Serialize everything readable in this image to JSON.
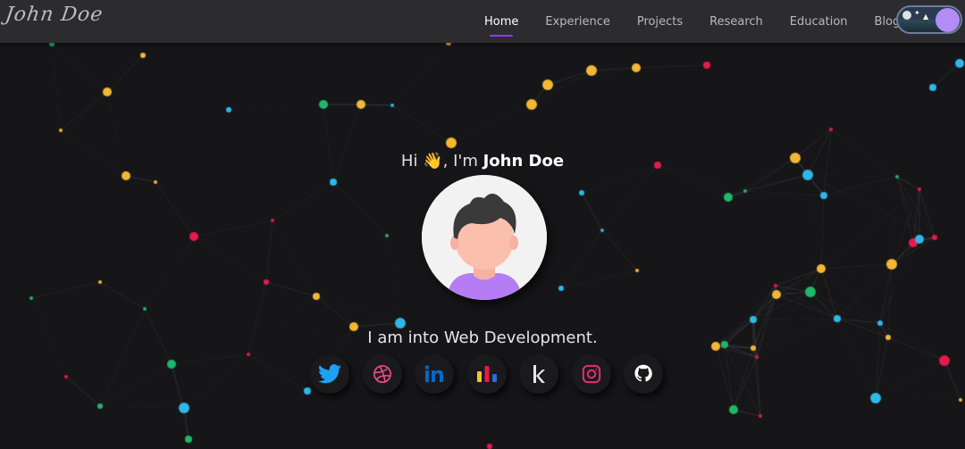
{
  "brand": {
    "logo_text": "John Doe"
  },
  "nav": {
    "items": [
      {
        "label": "Home",
        "active": true
      },
      {
        "label": "Experience",
        "active": false
      },
      {
        "label": "Projects",
        "active": false
      },
      {
        "label": "Research",
        "active": false
      },
      {
        "label": "Education",
        "active": false
      },
      {
        "label": "Blogs",
        "active": false
      }
    ]
  },
  "theme_toggle": {
    "icon": "night-forest-toggle-icon"
  },
  "hero": {
    "greeting_prefix": "Hi",
    "greeting_emoji": "👋",
    "greeting_middle": ", I'm",
    "name": "John Doe",
    "avatar_icon": "user-avatar-icon",
    "tagline": "I am into Web Development."
  },
  "socials": [
    {
      "icon": "twitter-icon",
      "color": "#1da1f2"
    },
    {
      "icon": "dribbble-icon",
      "color": "#ea4c89"
    },
    {
      "icon": "linkedin-icon",
      "color": "#0a66c2"
    },
    {
      "icon": "bar-chart-icon",
      "color": "#f4c430"
    },
    {
      "icon": "kaggle-icon",
      "color": "#e6e6e6"
    },
    {
      "icon": "instagram-icon",
      "color": "#e1306c"
    },
    {
      "icon": "github-icon",
      "color": "#ffffff"
    }
  ],
  "colors": {
    "background": "#161618",
    "navbar": "#2c2c2e",
    "accent": "#8b3cf7",
    "particle_colors": [
      "#f4b733",
      "#2db8e9",
      "#e8194d",
      "#1fb86b"
    ]
  }
}
